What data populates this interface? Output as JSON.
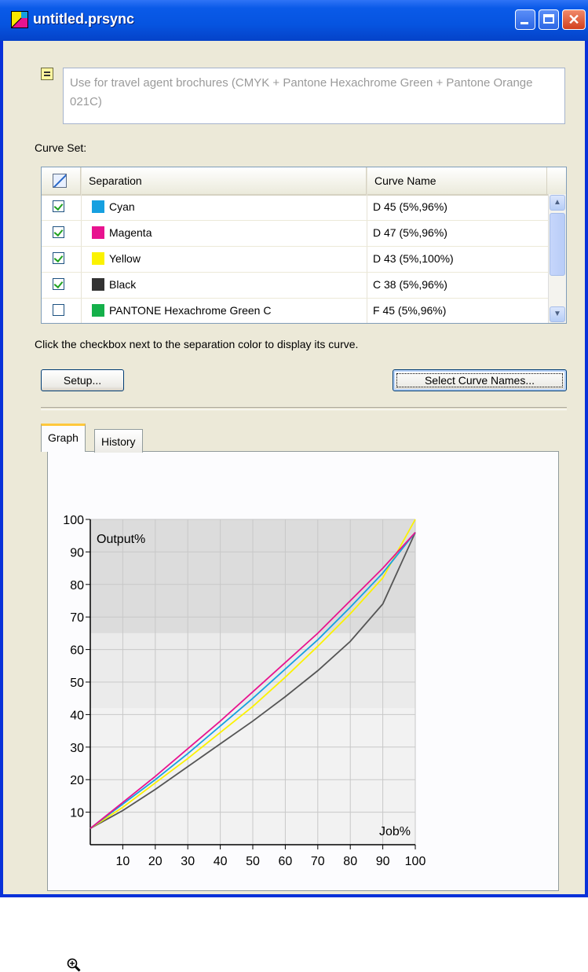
{
  "window": {
    "title": "untitled.prsync"
  },
  "description": "Use for travel agent brochures (CMYK + Pantone Hexachrome Green + Pantone Orange 021C)",
  "curve_set_label": "Curve Set:",
  "table": {
    "headers": {
      "separation": "Separation",
      "curve_name": "Curve Name"
    },
    "rows": [
      {
        "checked": true,
        "separation": "Cyan",
        "color": "#16a0e0",
        "curve": "D 45 (5%,96%)"
      },
      {
        "checked": true,
        "separation": "Magenta",
        "color": "#e8138f",
        "curve": "D 47 (5%,96%)"
      },
      {
        "checked": true,
        "separation": "Yellow",
        "color": "#fbf200",
        "curve": "D 43 (5%,100%)"
      },
      {
        "checked": true,
        "separation": "Black",
        "color": "#333333",
        "curve": "C 38 (5%,96%)"
      },
      {
        "checked": false,
        "separation": "PANTONE Hexachrome Green C",
        "color": "#14b04a",
        "curve": "F 45 (5%,96%)"
      }
    ]
  },
  "hint": "Click the checkbox next to the separation color to display its curve.",
  "buttons": {
    "setup": "Setup...",
    "select_curve_names": "Select Curve Names..."
  },
  "tabs": [
    {
      "label": "Graph",
      "active": true
    },
    {
      "label": "History",
      "active": false
    }
  ],
  "chart_data": {
    "type": "line",
    "xlabel": "Job%",
    "ylabel": "Output%",
    "xlim": [
      0,
      100
    ],
    "ylim": [
      0,
      100
    ],
    "x_ticks": [
      10,
      20,
      30,
      40,
      50,
      60,
      70,
      80,
      90,
      100
    ],
    "y_ticks": [
      10,
      20,
      30,
      40,
      50,
      60,
      70,
      80,
      90,
      100
    ],
    "grid": true,
    "x": [
      0,
      10,
      20,
      30,
      40,
      50,
      60,
      70,
      80,
      90,
      100
    ],
    "series": [
      {
        "name": "Magenta",
        "color": "#e8138f",
        "values": [
          5,
          13,
          21,
          29.5,
          38,
          47,
          56,
          65,
          75,
          85,
          96
        ]
      },
      {
        "name": "Cyan",
        "color": "#16a0e0",
        "values": [
          5,
          12.5,
          20,
          28,
          36.5,
          45,
          54,
          63,
          73,
          83.5,
          96
        ]
      },
      {
        "name": "Yellow",
        "color": "#fbf200",
        "values": [
          5,
          11.5,
          19,
          26.5,
          34.5,
          42.5,
          51.5,
          61,
          71,
          82,
          100
        ]
      },
      {
        "name": "Black",
        "color": "#555555",
        "values": [
          5,
          10.5,
          17,
          24,
          31,
          38,
          45.5,
          53.5,
          62.5,
          74,
          96
        ]
      }
    ]
  }
}
